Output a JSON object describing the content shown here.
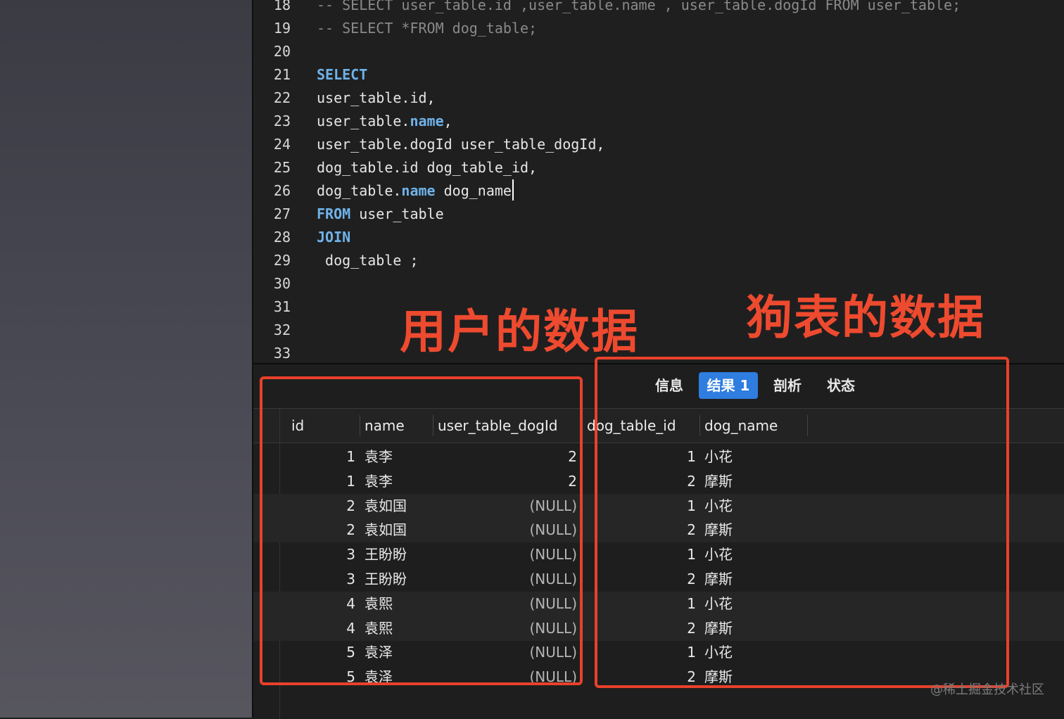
{
  "editor": {
    "lines": [
      {
        "n": "18",
        "tokens": [
          {
            "t": "-- SELECT user_table.id ,user_table.name , user_table.dogId FROM user_table;",
            "c": "comment"
          }
        ]
      },
      {
        "n": "19",
        "tokens": [
          {
            "t": "-- SELECT *FROM dog_table;",
            "c": "comment"
          }
        ]
      },
      {
        "n": "20",
        "tokens": []
      },
      {
        "n": "21",
        "tokens": [
          {
            "t": "SELECT",
            "c": "kw"
          }
        ]
      },
      {
        "n": "22",
        "tokens": [
          {
            "t": "user_table.id,",
            "c": "plain"
          }
        ]
      },
      {
        "n": "23",
        "tokens": [
          {
            "t": "user_table.",
            "c": "plain"
          },
          {
            "t": "name",
            "c": "kw"
          },
          {
            "t": ",",
            "c": "plain"
          }
        ]
      },
      {
        "n": "24",
        "tokens": [
          {
            "t": "user_table.dogId user_table_dogId,",
            "c": "plain"
          }
        ]
      },
      {
        "n": "25",
        "tokens": [
          {
            "t": "dog_table.id dog_table_id,",
            "c": "plain"
          }
        ]
      },
      {
        "n": "26",
        "tokens": [
          {
            "t": "dog_table.",
            "c": "plain"
          },
          {
            "t": "name",
            "c": "kw"
          },
          {
            "t": " dog_name",
            "c": "plain"
          }
        ],
        "caret": true
      },
      {
        "n": "27",
        "tokens": [
          {
            "t": "FROM",
            "c": "kw"
          },
          {
            "t": " user_table",
            "c": "plain"
          }
        ]
      },
      {
        "n": "28",
        "tokens": [
          {
            "t": "JOIN",
            "c": "kw"
          }
        ]
      },
      {
        "n": "29",
        "tokens": [
          {
            "t": " dog_table ;",
            "c": "plain"
          }
        ]
      },
      {
        "n": "30",
        "tokens": []
      },
      {
        "n": "31",
        "tokens": []
      },
      {
        "n": "32",
        "tokens": []
      },
      {
        "n": "33",
        "tokens": []
      }
    ]
  },
  "tabs": [
    {
      "label": "信息",
      "active": false
    },
    {
      "label": "结果 1",
      "active": true
    },
    {
      "label": "剖析",
      "active": false
    },
    {
      "label": "状态",
      "active": false
    }
  ],
  "table": {
    "columns": [
      "id",
      "name",
      "user_table_dogId",
      "dog_table_id",
      "dog_name"
    ],
    "rows": [
      [
        "1",
        "袁李",
        "2",
        "1",
        "小花"
      ],
      [
        "1",
        "袁李",
        "2",
        "2",
        "摩斯"
      ],
      [
        "2",
        "袁如国",
        "(NULL)",
        "1",
        "小花"
      ],
      [
        "2",
        "袁如国",
        "(NULL)",
        "2",
        "摩斯"
      ],
      [
        "3",
        "王盼盼",
        "(NULL)",
        "1",
        "小花"
      ],
      [
        "3",
        "王盼盼",
        "(NULL)",
        "2",
        "摩斯"
      ],
      [
        "4",
        "袁熙",
        "(NULL)",
        "1",
        "小花"
      ],
      [
        "4",
        "袁熙",
        "(NULL)",
        "2",
        "摩斯"
      ],
      [
        "5",
        "袁泽",
        "(NULL)",
        "1",
        "小花"
      ],
      [
        "5",
        "袁泽",
        "(NULL)",
        "2",
        "摩斯"
      ]
    ]
  },
  "annotations": {
    "user_label": "用户的数据",
    "dog_label": "狗表的数据",
    "color": "#e8412b"
  },
  "watermark": "@稀土掘金技术社区",
  "colors": {
    "keyword": "#6fb3ea",
    "comment": "#8a8a8a",
    "active_tab": "#2f7ddf"
  }
}
